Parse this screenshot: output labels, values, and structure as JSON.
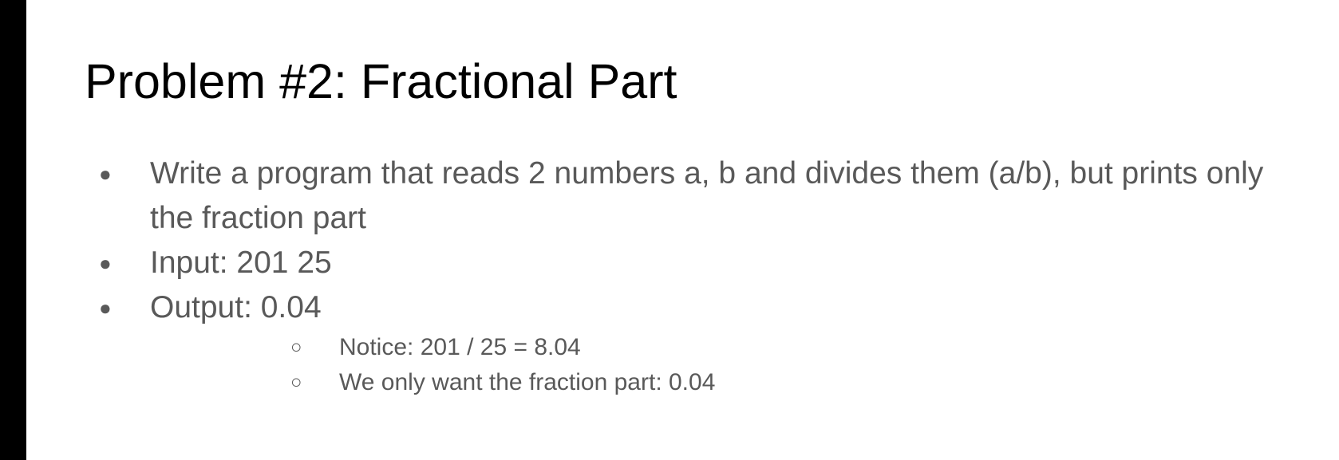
{
  "slide": {
    "title": "Problem #2: Fractional Part",
    "bullets": [
      {
        "marker": "●",
        "text": "Write a program that reads 2 numbers a, b and divides them (a/b), but prints only the fraction part"
      },
      {
        "marker": "●",
        "text": "Input: 201 25"
      },
      {
        "marker": "●",
        "text": "Output: 0.04"
      }
    ],
    "sub_bullets": [
      {
        "marker": "○",
        "text": "Notice: 201 / 25 = 8.04"
      },
      {
        "marker": "○",
        "text": "We only want the fraction part: 0.04"
      }
    ]
  },
  "colors": {
    "title": "#000000",
    "body_text": "#595959",
    "left_bar": "#000000",
    "background": "#ffffff"
  }
}
